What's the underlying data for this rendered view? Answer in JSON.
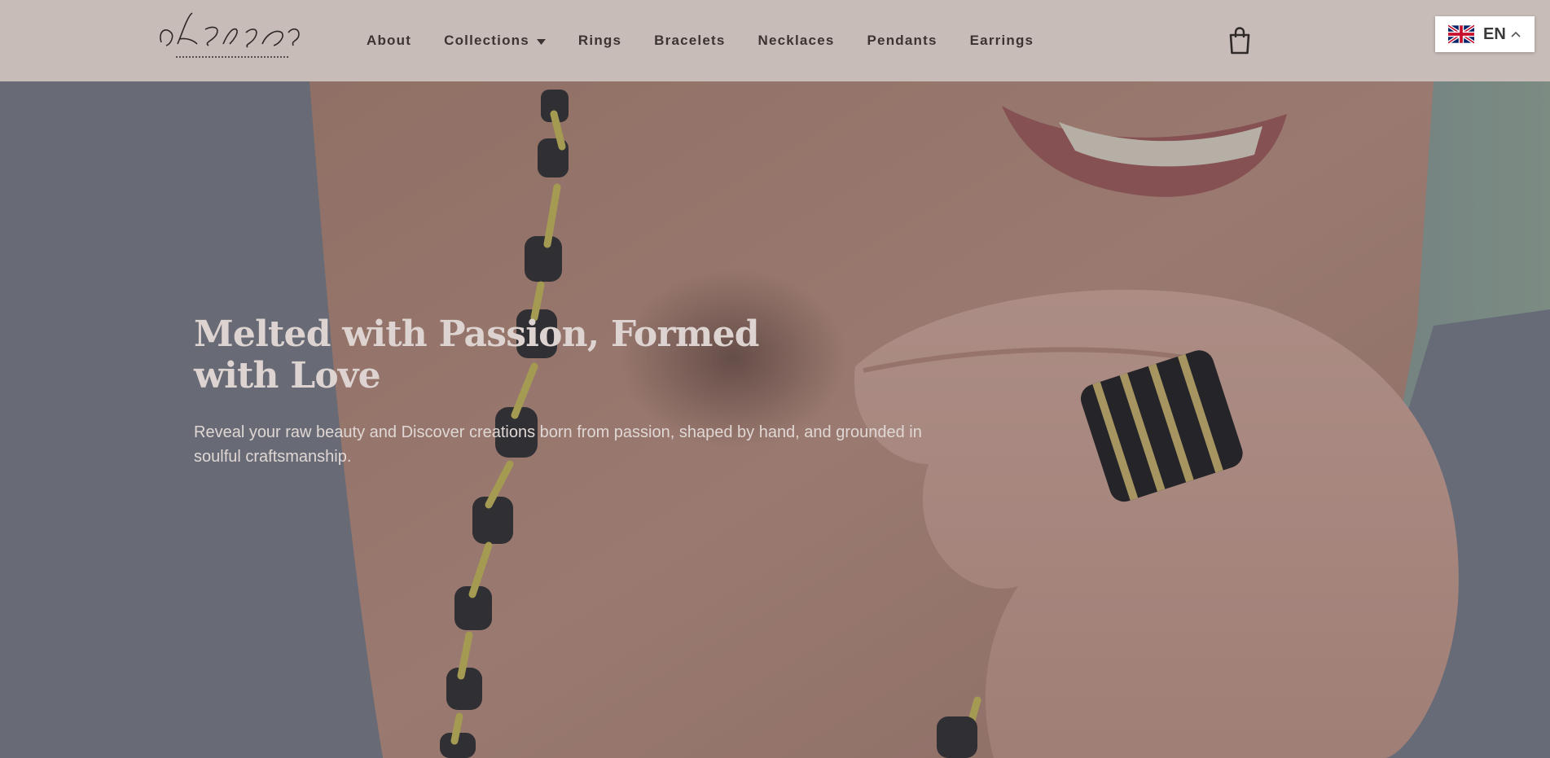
{
  "header": {
    "logo": {
      "hebrew_text": "אהוד ברלב",
      "tagline": "EHUD BARLEV JEWELRY ARTIST"
    },
    "nav": [
      {
        "label": "About"
      },
      {
        "label": "Collections",
        "has_dropdown": true
      },
      {
        "label": "Rings"
      },
      {
        "label": "Bracelets"
      },
      {
        "label": "Necklaces"
      },
      {
        "label": "Pendants"
      },
      {
        "label": "Earrings"
      }
    ],
    "cart_icon": "shopping-bag-icon",
    "language": {
      "code": "EN",
      "flag_icon": "uk-flag-icon"
    }
  },
  "hero": {
    "title": "Melted with Passion, Formed with Love",
    "subtitle": "Reveal your raw beauty and Discover creations born from passion, shaped by hand, and grounded in soulful craftsmanship."
  },
  "colors": {
    "header_bg": "#c8bcb8",
    "nav_text": "#3b3432",
    "hero_title": "#ddd3d0",
    "hero_text": "#e0d7d4"
  }
}
